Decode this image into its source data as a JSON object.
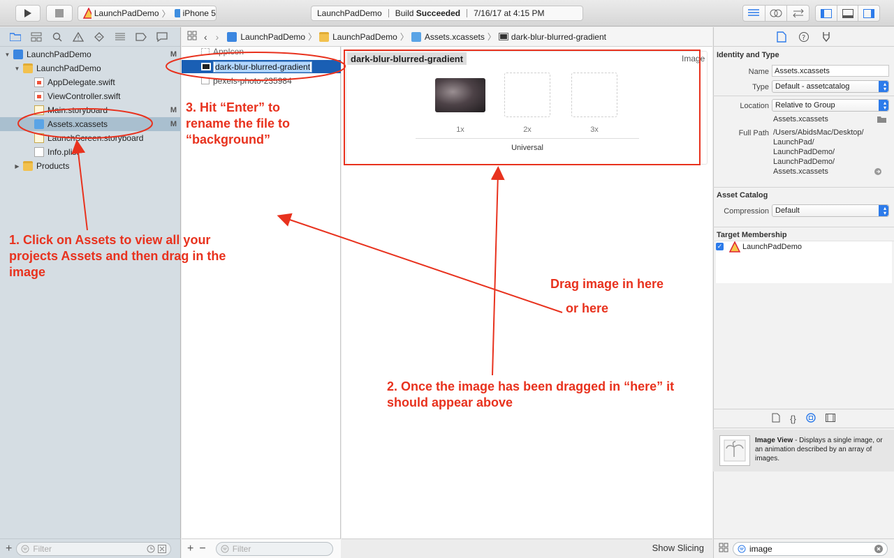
{
  "toolbar": {
    "scheme": {
      "project": "LaunchPadDemo",
      "device": "iPhone 5"
    },
    "activity": {
      "project": "LaunchPadDemo",
      "status_prefix": "Build",
      "status_bold": "Succeeded",
      "timestamp": "7/16/17 at 4:15 PM"
    }
  },
  "navigator": {
    "tree": [
      {
        "label": "LaunchPadDemo",
        "badge": "M"
      },
      {
        "label": "LaunchPadDemo",
        "badge": ""
      },
      {
        "label": "AppDelegate.swift",
        "badge": ""
      },
      {
        "label": "ViewController.swift",
        "badge": ""
      },
      {
        "label": "Main.storyboard",
        "badge": "M"
      },
      {
        "label": "Assets.xcassets",
        "badge": "M"
      },
      {
        "label": "LaunchScreen.storyboard",
        "badge": ""
      },
      {
        "label": "Info.plist",
        "badge": ""
      },
      {
        "label": "Products",
        "badge": ""
      }
    ],
    "filter_placeholder": "Filter"
  },
  "jumpbar": {
    "crumbs": [
      "LaunchPadDemo",
      "LaunchPadDemo",
      "Assets.xcassets",
      "dark-blur-blurred-gradient"
    ]
  },
  "asset_list": {
    "items": [
      "AppIcon",
      "dark-blur-blurred-gradient",
      "pexels-photo-235984"
    ],
    "filter_placeholder": "Filter"
  },
  "editor": {
    "imageset_name": "dark-blur-blurred-gradient",
    "kind": "Image",
    "scales": [
      "1x",
      "2x",
      "3x"
    ],
    "idiom": "Universal",
    "show_slicing": "Show Slicing"
  },
  "inspector": {
    "identity_title": "Identity and Type",
    "name_label": "Name",
    "name_value": "Assets.xcassets",
    "type_label": "Type",
    "type_value": "Default - assetcatalog",
    "location_label": "Location",
    "location_value": "Relative to Group",
    "location_file": "Assets.xcassets",
    "fullpath_label": "Full Path",
    "fullpath_lines": [
      "/Users/AbidsMac/Desktop/",
      "LaunchPad/",
      "LaunchPadDemo/",
      "LaunchPadDemo/",
      "Assets.xcassets"
    ],
    "catalog_title": "Asset Catalog",
    "compression_label": "Compression",
    "compression_value": "Default",
    "membership_title": "Target Membership",
    "membership_target": "LaunchPadDemo",
    "library_item_title": "Image View",
    "library_item_desc": " - Displays a single image, or an animation described by an array of images.",
    "library_search": "image"
  },
  "annotations": {
    "step1_line1_a": "1. Click on ",
    "step1_line1_b": "Assets",
    "step1_line1_c": " to view all your",
    "step1_line2_a": "projects ",
    "step1_line2_b": "Assets",
    "step1_line2_c": "  and then drag in the",
    "step1_line3": "image",
    "step3_line1": "3. Hit “Enter” to",
    "step3_line2": "rename the file to",
    "step3_line3": "“background”",
    "drag_here": "Drag image in here",
    "or_here": "or here",
    "step2_line1": "2. Once the image has been dragged in “here” it",
    "step2_line2": "should appear above"
  },
  "colors": {
    "annotation": "#e8321e",
    "selection": "#1a5fb4"
  }
}
